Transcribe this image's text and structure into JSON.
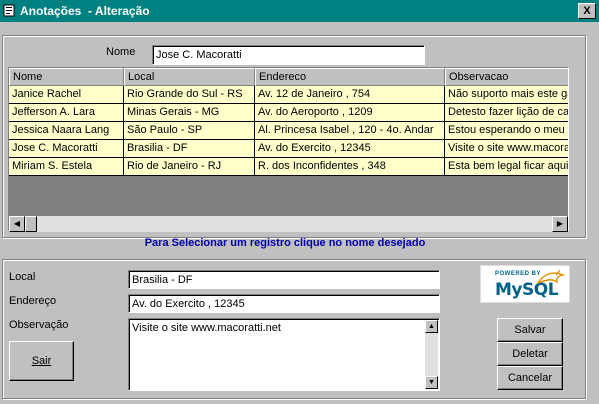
{
  "window": {
    "title": "Anotações  - Alteração",
    "close_label": "X"
  },
  "search": {
    "name_label": "Nome",
    "name_value": "Jose C. Macoratti"
  },
  "grid": {
    "columns": [
      "Nome",
      "Local",
      "Endereco",
      "Observacao"
    ],
    "rows": [
      [
        "Janice Rachel",
        "Rio Grande do Sul - RS",
        "Av. 12 de Janeiro ,  754",
        "Não suporto mais este gar"
      ],
      [
        "Jefferson A. Lara",
        "Minas Gerais - MG",
        "Av. do Aeroporto , 1209",
        "Detesto fazer lição de cas"
      ],
      [
        "Jessica Naara Lang",
        "São Paulo - SP",
        "Al. Princesa Isabel , 120 - 4o. Andar",
        "Estou esperando o meu pri"
      ],
      [
        "Jose C. Macoratti",
        "Brasilia - DF",
        "Av. do Exercito , 12345",
        "Visite o site www.macoratt"
      ],
      [
        "Miriam S. Estela",
        "Rio de Janeiro - RJ",
        "R. dos Inconfidentes , 348",
        "Esta bem legal ficar aqui s"
      ]
    ],
    "row_color": "#ffffcc"
  },
  "hint": "Para Selecionar um registro clique no nome desejado",
  "detail": {
    "local_label": "Local",
    "local_value": "Brasilia - DF",
    "endereco_label": "Endereço",
    "endereco_value": "Av. do Exercito , 12345",
    "observacao_label": "Observação",
    "observacao_value": "Visite o site www.macoratti.net"
  },
  "buttons": {
    "sair": "Sair",
    "salvar": "Salvar",
    "deletar": "Deletar",
    "cancelar": "Cancelar"
  },
  "logo": {
    "powered_by": "POWERED BY",
    "brand": "MySQL",
    "brand_color": "#00618a",
    "accent_color": "#e48e00"
  },
  "colors": {
    "titlebar": "#008080",
    "face": "#c0c0c0",
    "hint": "#0000aa"
  }
}
